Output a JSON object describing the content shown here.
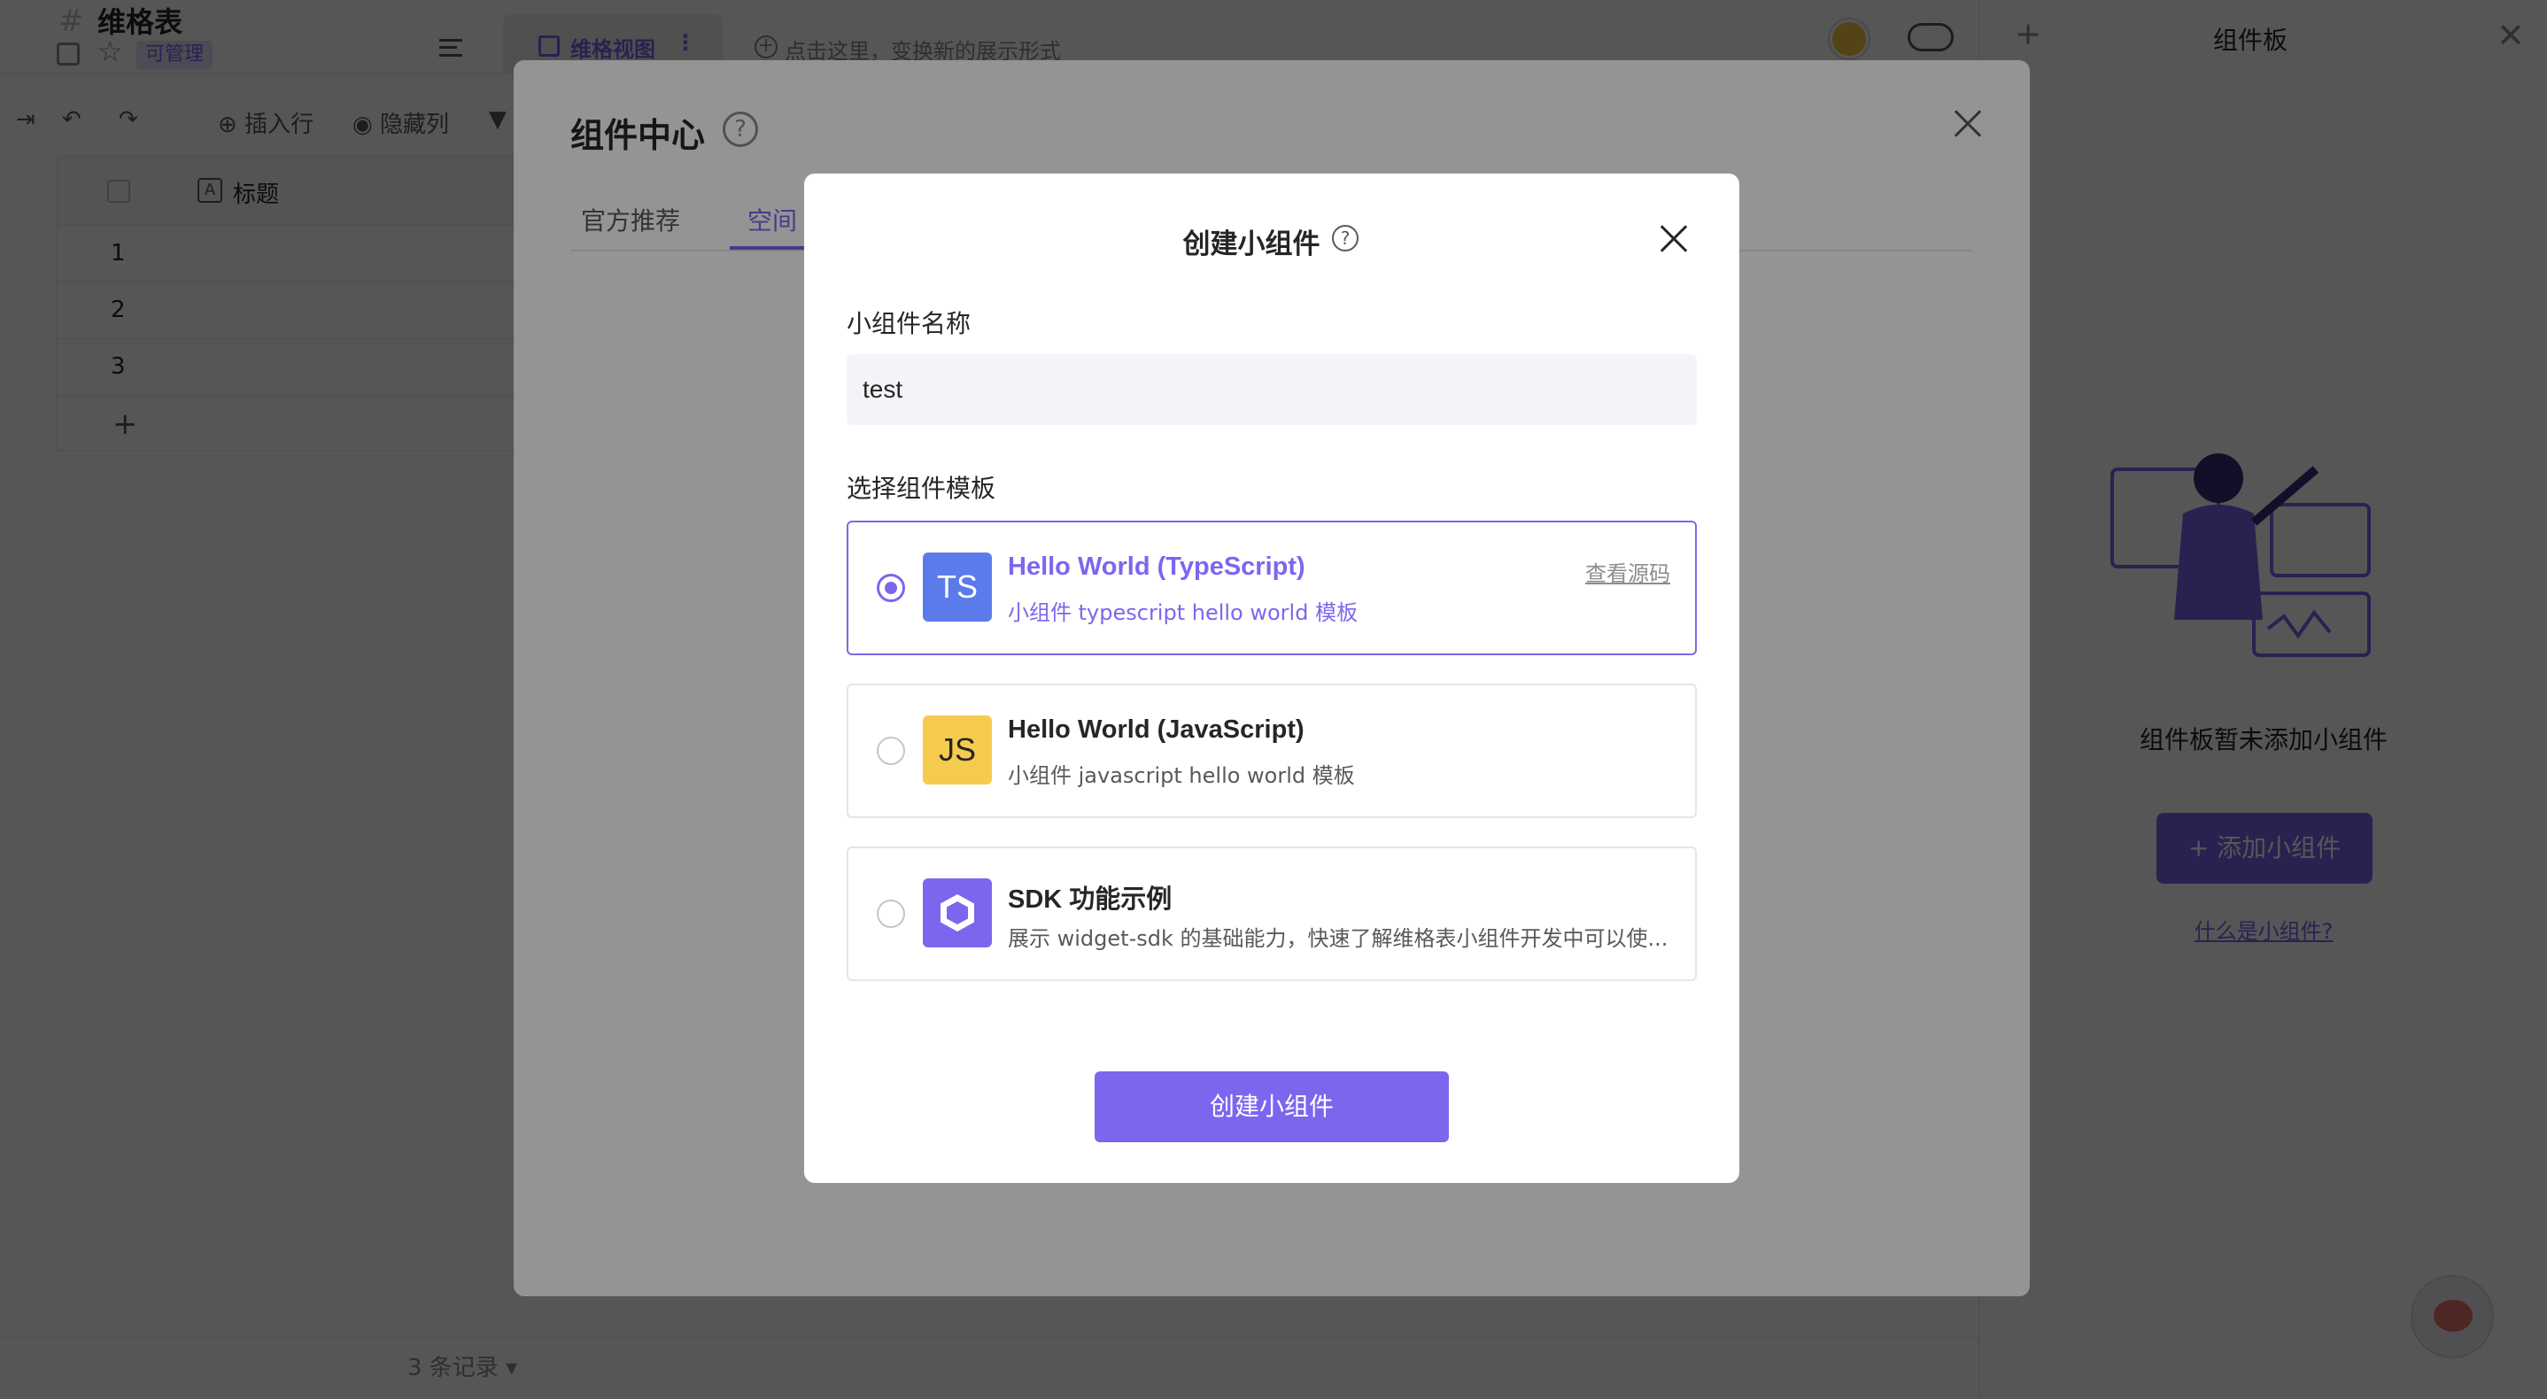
{
  "app": {
    "sheet_title": "维格表",
    "permission_badge": "可管理",
    "view_tab_label": "维格视图",
    "view_tab_more": "⋮",
    "add_view_hint": "点击这里，变换新的展示形式",
    "toolbar": {
      "insert_row": "插入行",
      "hidden_columns": "隐藏列"
    },
    "grid": {
      "column_title": "标题",
      "column_icon": "A",
      "rows": [
        "1",
        "2",
        "3"
      ],
      "add_row": "+"
    },
    "record_count": "3 条记录 ▾"
  },
  "right_panel": {
    "plus": "+",
    "title": "组件板",
    "close": "✕",
    "empty_text": "组件板暂未添加小组件",
    "add_button": "+ 添加小组件",
    "what_link": "什么是小组件?"
  },
  "component_center": {
    "title": "组件中心",
    "help": "?",
    "tabs": [
      "官方推荐",
      "空间"
    ]
  },
  "create_dialog": {
    "title": "创建小组件",
    "help": "?",
    "name_label": "小组件名称",
    "name_value": "test",
    "template_label": "选择组件模板",
    "templates": [
      {
        "icon_text": "TS",
        "name": "Hello World (TypeScript)",
        "desc": "小组件 typescript hello world 模板",
        "source_link": "查看源码",
        "selected": true
      },
      {
        "icon_text": "JS",
        "name": "Hello World (JavaScript)",
        "desc": "小组件 javascript hello world 模板",
        "selected": false
      },
      {
        "icon_text": "",
        "name": "SDK 功能示例",
        "desc": "展示 widget-sdk 的基础能力，快速了解维格表小组件开发中可以使...",
        "selected": false
      }
    ],
    "create_button": "创建小组件"
  },
  "colors": {
    "accent": "#7b67ee",
    "ts_icon": "#5b7bea",
    "js_icon": "#f5cb4e"
  }
}
